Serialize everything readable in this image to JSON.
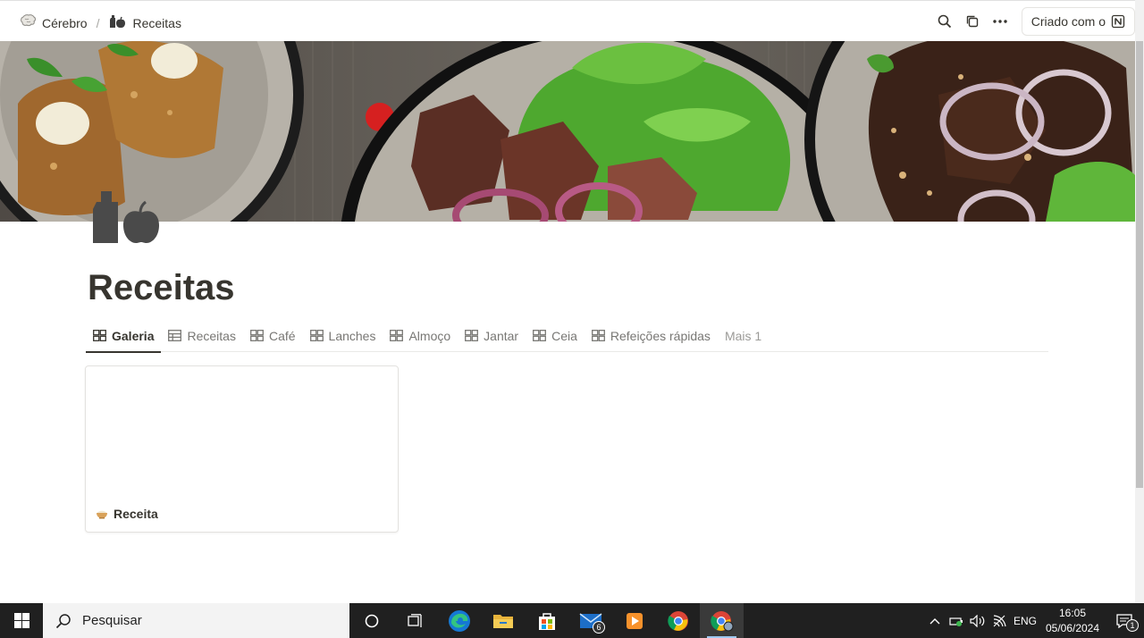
{
  "breadcrumb": {
    "workspace": "Cérebro",
    "separator": "/",
    "page": "Receitas"
  },
  "header": {
    "made_with": "Criado com o"
  },
  "page": {
    "title": "Receitas"
  },
  "tabs": [
    {
      "label": "Galeria",
      "active": true,
      "icon": "gallery-icon"
    },
    {
      "label": "Receitas",
      "active": false,
      "icon": "table-icon"
    },
    {
      "label": "Café",
      "active": false,
      "icon": "gallery-icon"
    },
    {
      "label": "Lanches",
      "active": false,
      "icon": "gallery-icon"
    },
    {
      "label": "Almoço",
      "active": false,
      "icon": "gallery-icon"
    },
    {
      "label": "Jantar",
      "active": false,
      "icon": "gallery-icon"
    },
    {
      "label": "Ceia",
      "active": false,
      "icon": "gallery-icon"
    },
    {
      "label": "Refeições rápidas",
      "active": false,
      "icon": "gallery-icon"
    }
  ],
  "more_tabs": "Mais 1",
  "gallery": {
    "cards": [
      {
        "title": "Receita",
        "icon": "bowl-icon"
      }
    ]
  },
  "taskbar": {
    "search_placeholder": "Pesquisar",
    "mail_badge": "6",
    "language": "ENG",
    "time": "16:05",
    "date": "05/06/2024",
    "notification_badge": "1"
  },
  "colors": {
    "text": "#37352f",
    "muted": "#787774",
    "taskbar": "#202020"
  }
}
